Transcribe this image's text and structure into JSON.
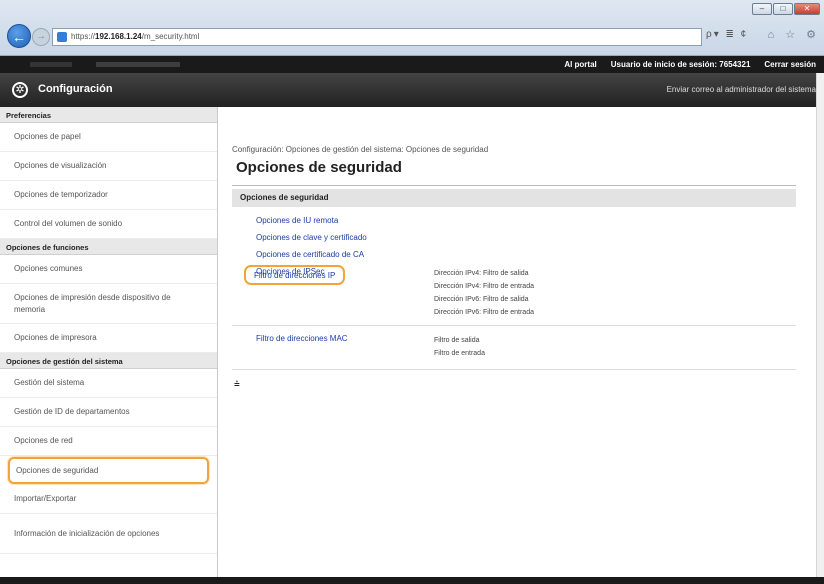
{
  "browser": {
    "url_prefix": "https://",
    "url_host": "192.168.1.24",
    "url_path": "/m_security.html",
    "addr_tools": "ρ▾ ≣ ¢",
    "tb_icons": "⌂ ☆ ⚙"
  },
  "topbar": {
    "portal": "Al portal",
    "user_label": "Usuario de inicio de sesión:",
    "user_id": "7654321",
    "logout": "Cerrar sesión"
  },
  "header": {
    "title": "Configuración",
    "mail_admin": "Enviar correo al administrador del sistema"
  },
  "sidebar": {
    "sections": [
      {
        "title": "Preferencias",
        "items": [
          "Opciones de papel",
          "Opciones de visualización",
          "Opciones de temporizador",
          "Control del volumen de sonido"
        ]
      },
      {
        "title": "Opciones de funciones",
        "items": [
          "Opciones comunes",
          "Opciones de impresión desde dispositivo de memoria",
          "Opciones de impresora"
        ]
      },
      {
        "title": "Opciones de gestión del sistema",
        "items": [
          "Gestión del sistema",
          "Gestión de ID de departamentos",
          "Opciones de red",
          "Opciones de seguridad",
          "Importar/Exportar",
          "Información de inicialización de opciones"
        ]
      }
    ]
  },
  "main": {
    "breadcrumb": "Configuración: Opciones de gestión del sistema: Opciones de seguridad",
    "title": "Opciones de seguridad",
    "section_title": "Opciones de seguridad",
    "links": [
      "Opciones de IU remota",
      "Opciones de clave y certificado",
      "Opciones de certificado de CA",
      "Opciones de IPSec",
      "Filtro de direcciones IP",
      "Filtro de direcciones MAC"
    ],
    "ip_values": [
      "Dirección IPv4: Filtro de salida",
      "Dirección IPv4: Filtro de entrada",
      "Dirección IPv6: Filtro de salida",
      "Dirección IPv6: Filtro de entrada"
    ],
    "mac_values": [
      "Filtro de salida",
      "Filtro de entrada"
    ]
  }
}
